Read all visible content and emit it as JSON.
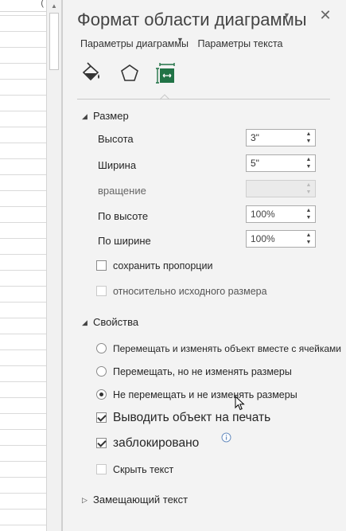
{
  "spreadsheet": {
    "header_fragment": "("
  },
  "pane": {
    "title": "Формат области диаграммы",
    "close_glyph": "✕",
    "subtabs": [
      {
        "label": "Параметры диаграммы",
        "active": true
      },
      {
        "label": "Параметры текста",
        "active": false
      }
    ],
    "icon_tabs": [
      "paint-bucket-icon",
      "pentagon-icon",
      "size-properties-icon"
    ],
    "active_icon_color": "#217346"
  },
  "size_section": {
    "title": "Размер",
    "expanded": true,
    "fields": [
      {
        "label": "Высота",
        "value": "3\"",
        "enabled": true
      },
      {
        "label": "Ширина",
        "value": "5\"",
        "enabled": true
      },
      {
        "label": "вращение",
        "value": "",
        "enabled": false
      },
      {
        "label": "По высоте",
        "value": "100%",
        "enabled": true
      },
      {
        "label": "По ширине",
        "value": "100%",
        "enabled": true
      }
    ],
    "checkboxes": [
      {
        "label": "сохранить пропорции",
        "checked": false,
        "enabled": true
      },
      {
        "label": "относительно исходного размера",
        "checked": false,
        "enabled": false
      }
    ]
  },
  "properties_section": {
    "title": "Свойства",
    "expanded": true,
    "radios": [
      {
        "label": "Перемещать и изменять объект вместе с ячейками",
        "checked": false
      },
      {
        "label": "Перемещать, но не изменять размеры",
        "checked": false
      },
      {
        "label": "Не перемещать и не изменять размеры",
        "checked": true
      }
    ],
    "checkboxes": [
      {
        "label": "Выводить объект на печать",
        "checked": true,
        "enabled": true
      },
      {
        "label": "заблокировано",
        "checked": true,
        "enabled": true
      },
      {
        "label": "Скрыть текст",
        "checked": false,
        "enabled": false
      }
    ]
  },
  "alt_text_section": {
    "title": "Замещающий текст",
    "expanded": false
  },
  "colors": {
    "pane_background": "#f3f3f3",
    "accent": "#217346"
  }
}
